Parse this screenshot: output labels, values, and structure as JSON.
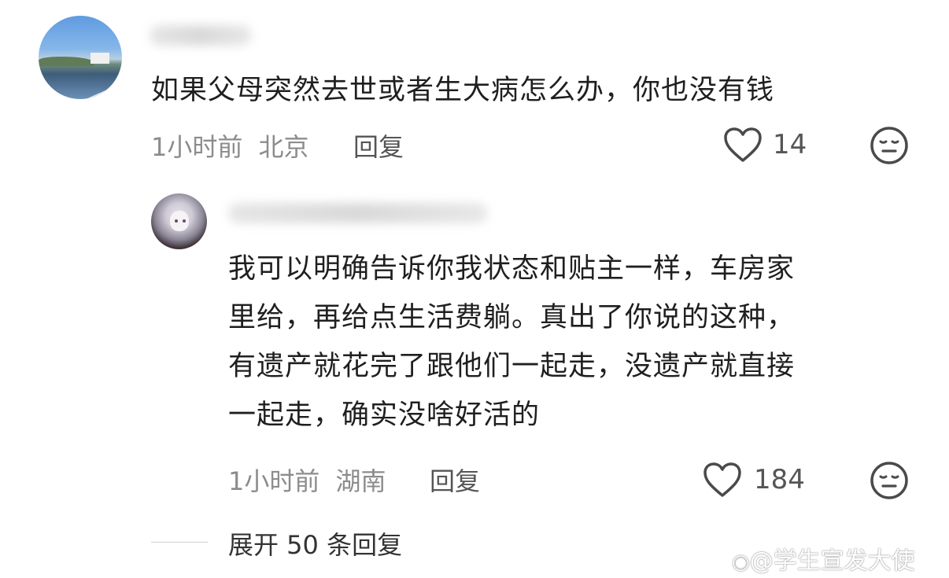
{
  "comment1": {
    "text": "如果父母突然去世或者生大病怎么办，你也没有钱",
    "time": "1小时前",
    "location": "北京",
    "reply_label": "回复",
    "like_count": "14",
    "like_icon": "heart-outline-icon",
    "dislike_icon": "meh-face-icon"
  },
  "comment2": {
    "text": "我可以明确告诉你我状态和贴主一样，车房家\n里给，再给点生活费躺。真出了你说的这种，\n有遗产就花完了跟他们一起走，没遗产就直接\n一起走，确实没啥好活的",
    "time": "1小时前",
    "location": "湖南",
    "reply_label": "回复",
    "like_count": "184",
    "like_icon": "heart-outline-icon",
    "dislike_icon": "meh-face-icon"
  },
  "expand_replies": "展开 50 条回复",
  "watermark": "@学生宣发大使",
  "colors": {
    "text": "#1f1f1f",
    "meta": "#8c8c8c",
    "icon": "#4a4a4a"
  }
}
